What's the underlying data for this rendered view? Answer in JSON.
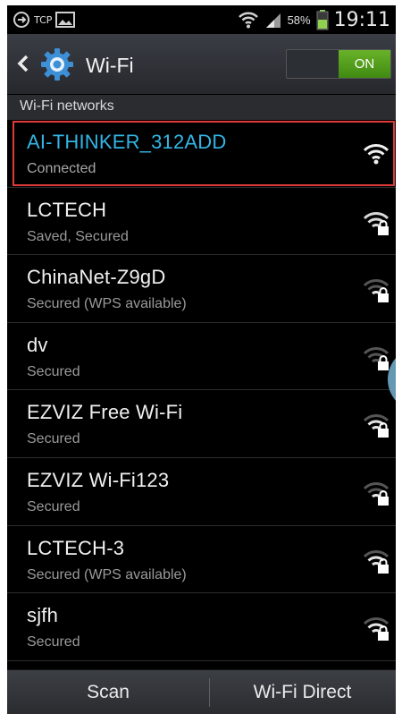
{
  "status_bar": {
    "label_tcp": "TCP",
    "battery": "58%",
    "time": "19:11"
  },
  "action_bar": {
    "title": "Wi-Fi",
    "toggle_label": "ON"
  },
  "section_header": "Wi-Fi networks",
  "networks": [
    {
      "ssid": "AI-THINKER_312ADD",
      "status": "Connected",
      "locked": false
    },
    {
      "ssid": "LCTECH",
      "status": "Saved, Secured",
      "locked": true
    },
    {
      "ssid": "ChinaNet-Z9gD",
      "status": "Secured (WPS available)",
      "locked": true
    },
    {
      "ssid": "dv",
      "status": "Secured",
      "locked": true
    },
    {
      "ssid": "EZVIZ Free Wi-Fi",
      "status": "Secured",
      "locked": true
    },
    {
      "ssid": "EZVIZ Wi-Fi123",
      "status": "Secured",
      "locked": true
    },
    {
      "ssid": "LCTECH-3",
      "status": "Secured (WPS available)",
      "locked": true
    },
    {
      "ssid": "sjfh",
      "status": "Secured",
      "locked": true
    }
  ],
  "bottom_bar": {
    "scan_label": "Scan",
    "wifi_direct_label": "Wi-Fi Direct"
  },
  "colors": {
    "accent": "#33b5e5",
    "toggle_on": "#4f9e1d",
    "highlight": "#e03a3a"
  }
}
